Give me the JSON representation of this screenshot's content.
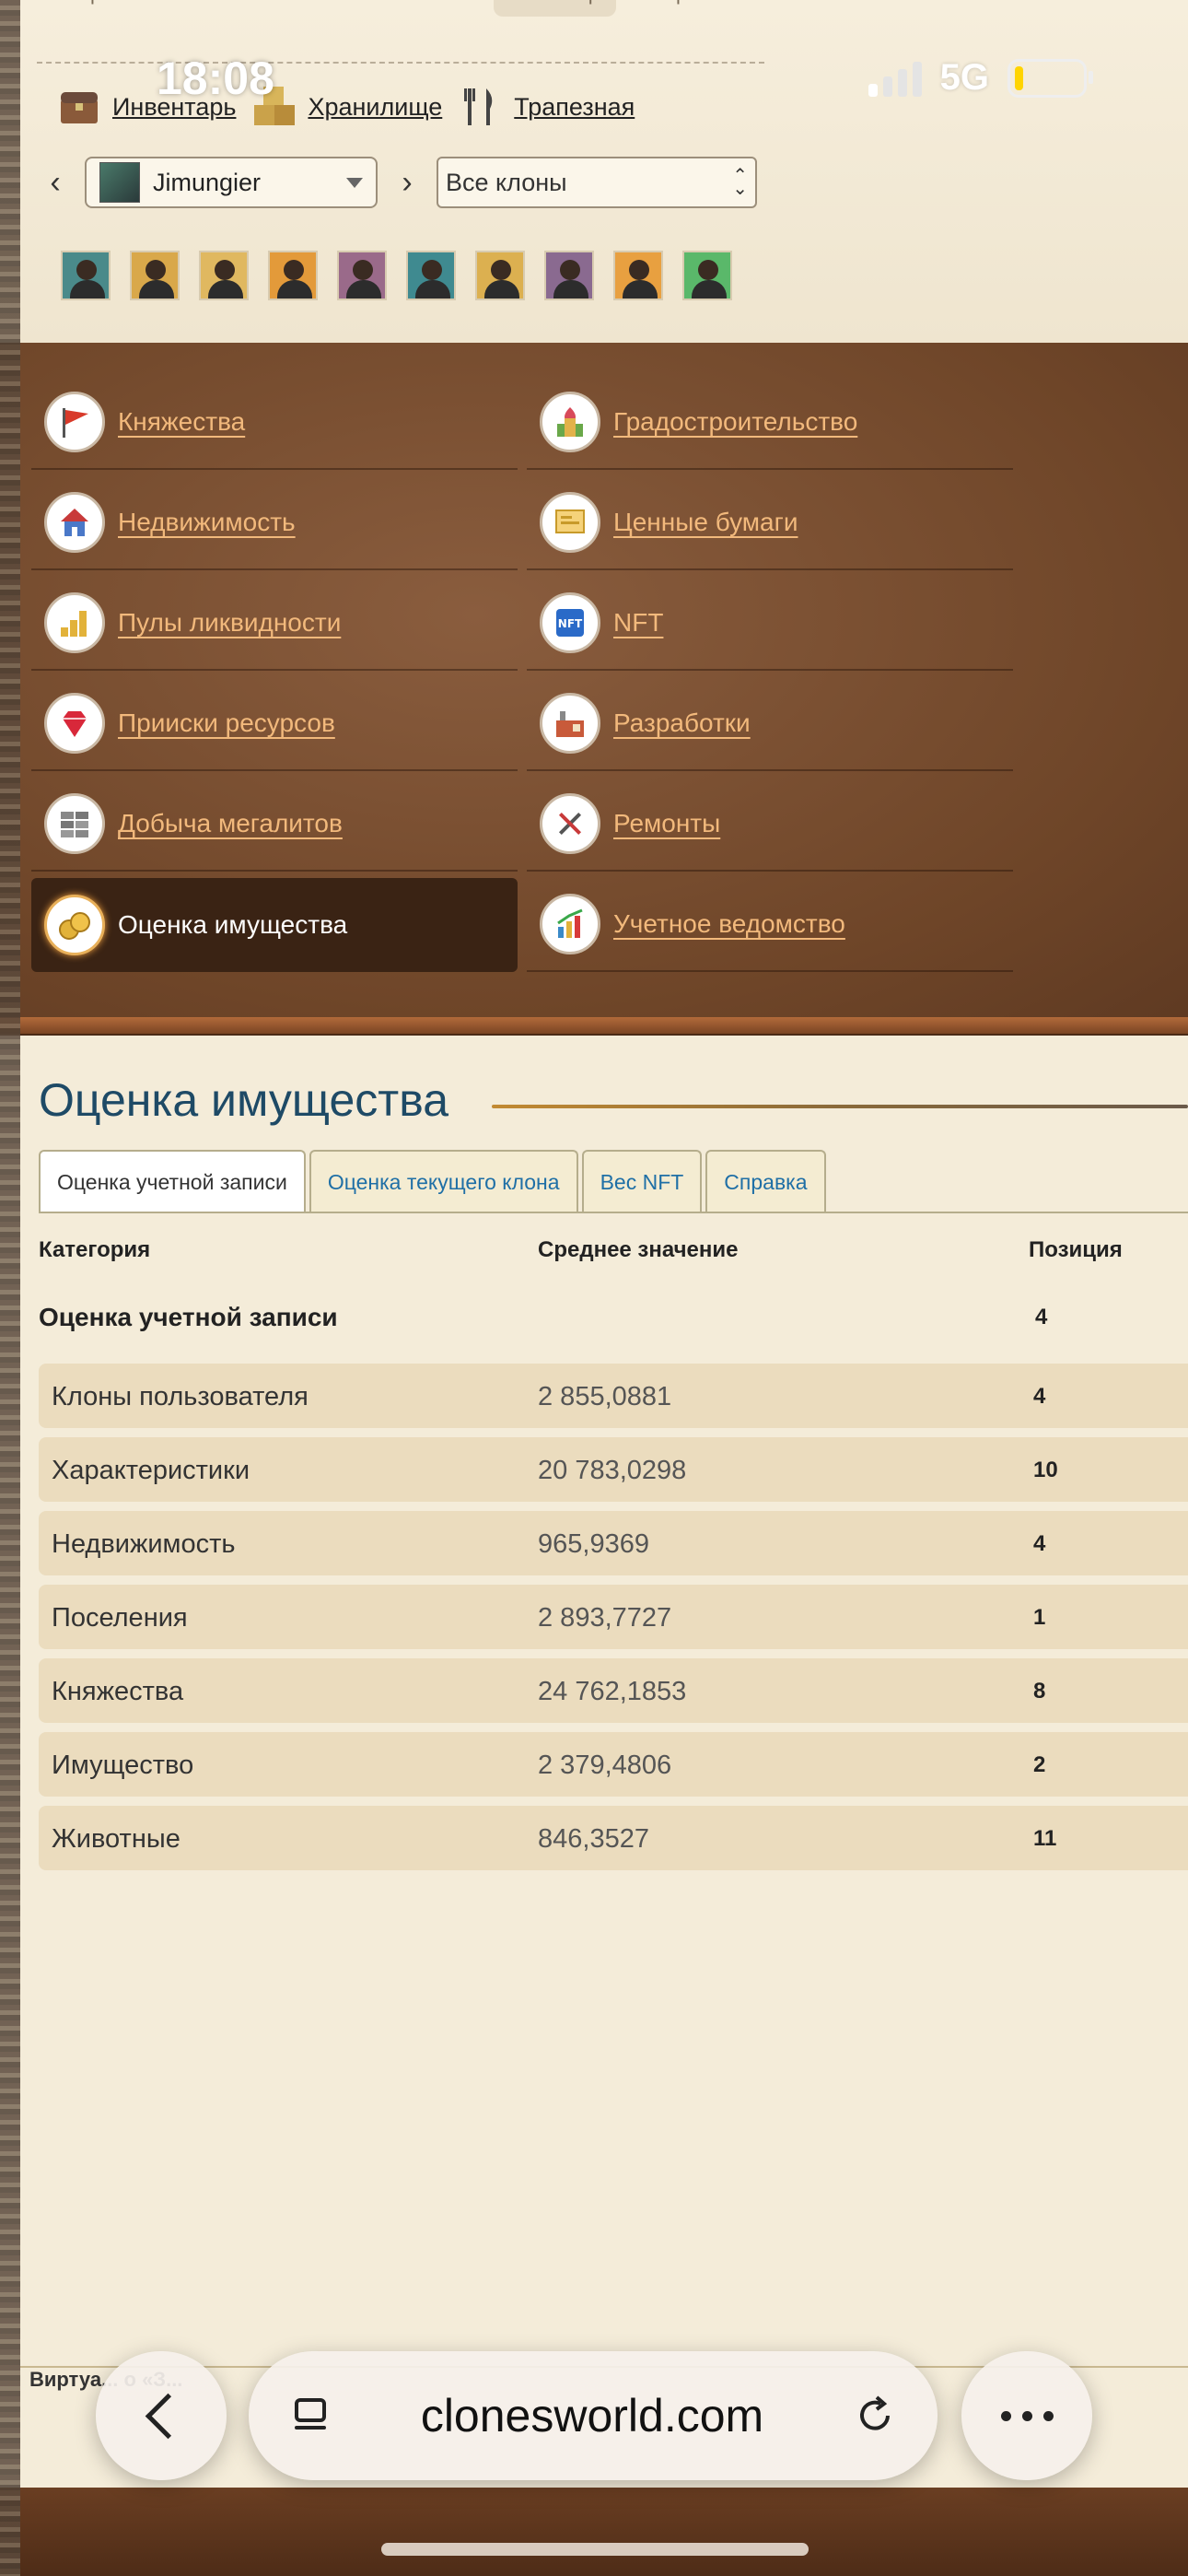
{
  "status": {
    "time": "18:08",
    "network": "5G"
  },
  "top_tabs_cut": [
    "Персонаж",
    "Работа",
    "Бизнес",
    "Инвестор",
    "Торговля"
  ],
  "toplinks": [
    {
      "label": "Инвентарь",
      "icon": "chest-icon"
    },
    {
      "label": "Хранилище",
      "icon": "boxes-icon"
    },
    {
      "label": "Трапезная",
      "icon": "fork-knife-icon"
    }
  ],
  "clone_selector": {
    "user": "Jimungier",
    "filter": "Все клоны"
  },
  "clone_avatars_count": 10,
  "menu": [
    {
      "label": "Княжества",
      "icon": "flag-icon"
    },
    {
      "label": "Градостроительство",
      "icon": "city-icon"
    },
    {
      "label": "Недвижимость",
      "icon": "house-icon"
    },
    {
      "label": "Ценные бумаги",
      "icon": "certificate-icon"
    },
    {
      "label": "Пулы ликвидности",
      "icon": "coin-stacks-icon"
    },
    {
      "label": "NFT",
      "icon": "nft-icon"
    },
    {
      "label": "Прииски ресурсов",
      "icon": "gem-icon"
    },
    {
      "label": "Разработки",
      "icon": "factory-icon"
    },
    {
      "label": "Добыча мегалитов",
      "icon": "bricks-icon"
    },
    {
      "label": "Ремонты",
      "icon": "tools-icon"
    },
    {
      "label": "Оценка имущества",
      "icon": "coins-icon",
      "active": true
    },
    {
      "label": "Учетное ведомство",
      "icon": "chart-icon"
    }
  ],
  "content": {
    "title": "Оценка имущества",
    "tabs": [
      "Оценка учетной записи",
      "Оценка текущего клона",
      "Вес NFT",
      "Справка"
    ],
    "columns": [
      "Категория",
      "Среднее значение",
      "Позиция"
    ],
    "summary": {
      "label": "Оценка учетной записи",
      "position": "4"
    },
    "rows": [
      {
        "category": "Клоны пользователя",
        "value": "2 855,0881",
        "position": "4"
      },
      {
        "category": "Характеристики",
        "value": "20 783,0298",
        "position": "10"
      },
      {
        "category": "Недвижимость",
        "value": "965,9369",
        "position": "4"
      },
      {
        "category": "Поселения",
        "value": "2 893,7727",
        "position": "1"
      },
      {
        "category": "Княжества",
        "value": "24 762,1853",
        "position": "8"
      },
      {
        "category": "Имущество",
        "value": "2 379,4806",
        "position": "2"
      },
      {
        "category": "Животные",
        "value": "846,3527",
        "position": "11"
      }
    ]
  },
  "footer": {
    "text": "Виртуа... о «З..."
  },
  "browser": {
    "url": "clonesworld.com"
  },
  "colors": {
    "menu_bg": "#6e4528",
    "link": "#f2b97c",
    "title": "#1e4a66",
    "tab_link": "#1f6fa6",
    "row_bg": "#ebdcbe"
  }
}
